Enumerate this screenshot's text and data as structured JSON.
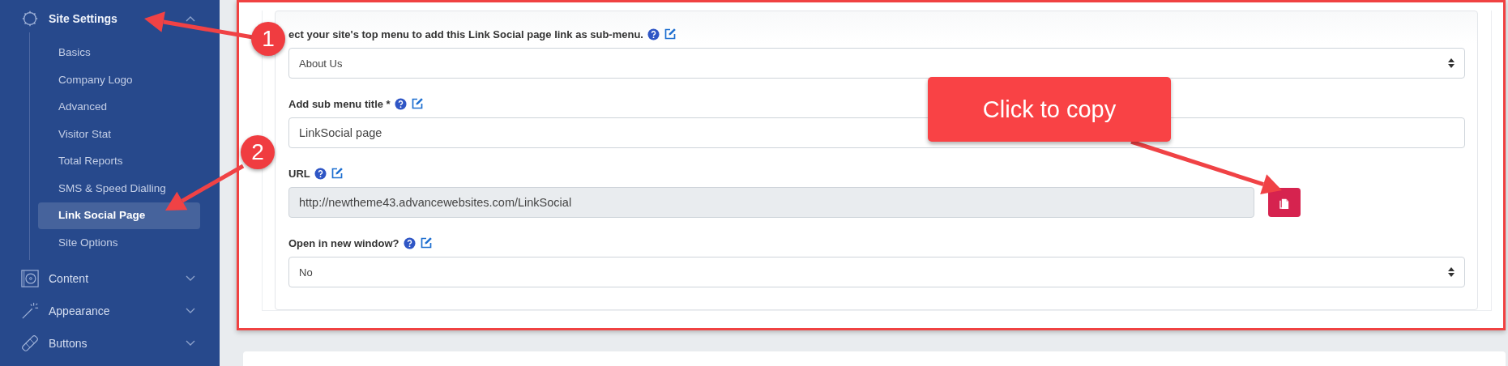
{
  "sidebar": {
    "items": [
      {
        "label": "Site Settings",
        "kind": "gear",
        "expanded": true,
        "children": [
          {
            "label": "Basics",
            "selected": false
          },
          {
            "label": "Company Logo",
            "selected": false
          },
          {
            "label": "Advanced",
            "selected": false
          },
          {
            "label": "Visitor Stat",
            "selected": false
          },
          {
            "label": "Total Reports",
            "selected": false
          },
          {
            "label": "SMS & Speed Dialling",
            "selected": false
          },
          {
            "label": "Link Social Page",
            "selected": true
          },
          {
            "label": "Site Options",
            "selected": false
          }
        ]
      },
      {
        "label": "Content",
        "kind": "disc",
        "expanded": false
      },
      {
        "label": "Appearance",
        "kind": "wand",
        "expanded": false
      },
      {
        "label": "Buttons",
        "kind": "bandage",
        "expanded": false
      }
    ]
  },
  "form": {
    "fields": [
      {
        "kind": "select",
        "label": "ect your site's top menu to add this Link Social page link as sub-menu.",
        "value": "About Us"
      },
      {
        "kind": "text",
        "label": "Add sub menu title *",
        "value": "LinkSocial page"
      },
      {
        "kind": "copy",
        "label": "URL",
        "value": "http://newtheme43.advancewebsites.com/LinkSocial"
      },
      {
        "kind": "select",
        "label": "Open in new window?",
        "value": "No"
      }
    ]
  },
  "annotations": {
    "callout": "Click to copy",
    "badges": [
      "1",
      "2"
    ]
  }
}
